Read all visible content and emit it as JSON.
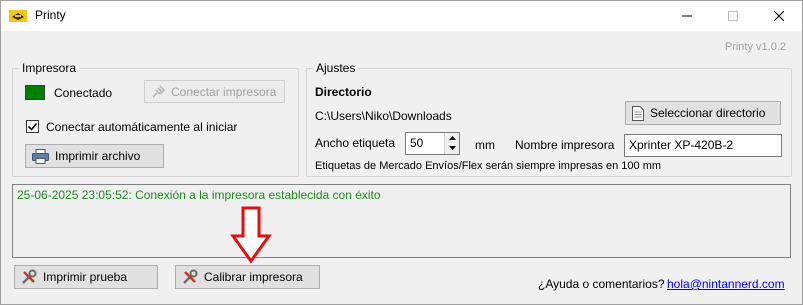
{
  "window": {
    "title": "Printy",
    "version": "Printy v1.0.2"
  },
  "printer_group": {
    "legend": "Impresora",
    "status_text": "Conectado",
    "status_color": "#008000",
    "connect_button": "Conectar impresora",
    "auto_connect_label": "Conectar automáticamente al iniciar",
    "auto_connect_checked": true,
    "print_file_button": "Imprimir archivo"
  },
  "settings_group": {
    "legend": "Ajustes",
    "directory_heading": "Directorio",
    "directory_path": "C:\\Users\\Niko\\Downloads",
    "select_directory_button": "Seleccionar directorio",
    "label_width_label": "Ancho etiqueta",
    "label_width_value": "50",
    "label_width_unit": "mm",
    "printer_name_label": "Nombre impresora",
    "printer_name_value": "Xprinter XP-420B-2",
    "note": "Etiquetas de Mercado Envíos/Flex serán siempre impresas en 100 mm"
  },
  "log": {
    "message": "25-06-2025 23:05:52: Conexión a la impresora establecida con éxito"
  },
  "footer": {
    "test_print_button": "Imprimir prueba",
    "calibrate_button": "Calibrar impresora",
    "help_text": "¿Ayuda o comentarios?",
    "contact_email": "hola@nintannerd.com"
  },
  "icons": {
    "app": "printy-logo-icon",
    "minimize": "minimize-icon",
    "maximize": "maximize-icon",
    "close": "close-icon",
    "connect": "plug-icon",
    "print": "printer-icon",
    "directory": "document-icon",
    "tools": "tools-icon",
    "annotation": "red-arrow-down-icon"
  }
}
